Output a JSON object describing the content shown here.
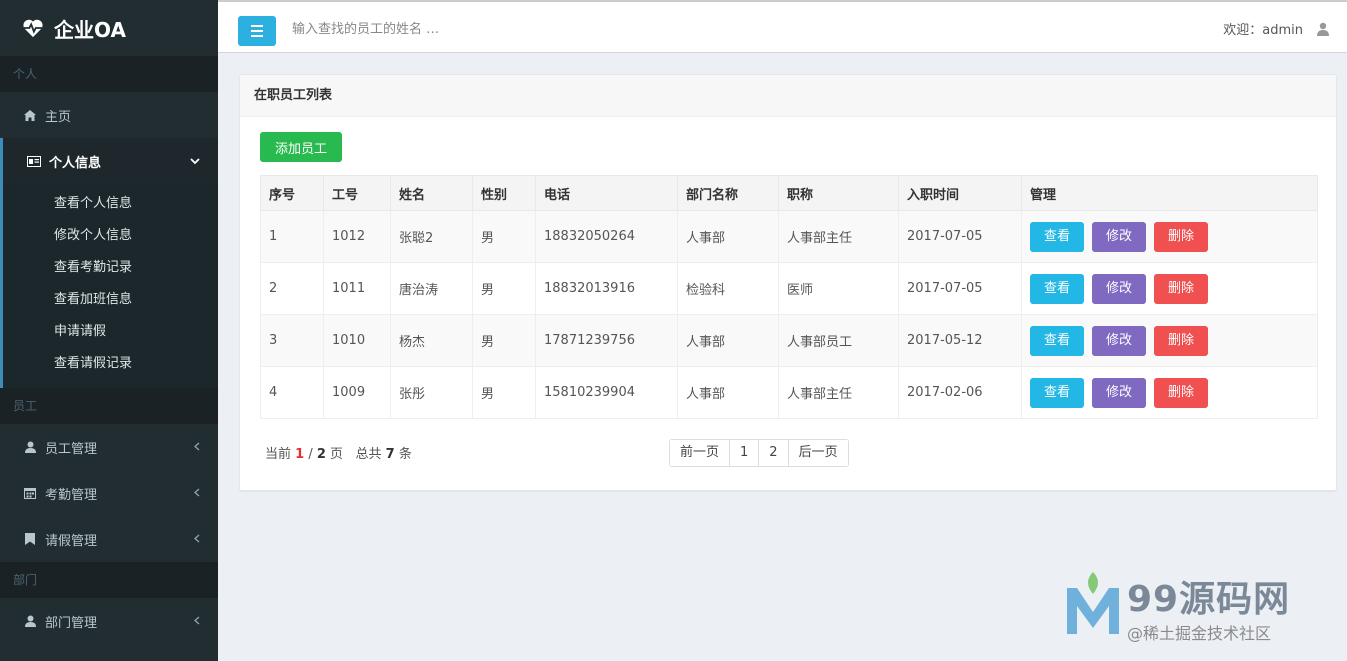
{
  "app": {
    "title": "企业OA"
  },
  "sidebar": {
    "sections": {
      "personal": "个人",
      "staff": "员工",
      "dept": "部门"
    },
    "home_label": "主页",
    "personal_info": {
      "label": "个人信息",
      "items": [
        "查看个人信息",
        "修改个人信息",
        "查看考勤记录",
        "查看加班信息",
        "申请请假",
        "查看请假记录"
      ]
    },
    "staff_mgmt": "员工管理",
    "attendance_mgmt": "考勤管理",
    "leave_mgmt": "请假管理",
    "dept_mgmt": "部门管理"
  },
  "header": {
    "search_placeholder": "输入查找的员工的姓名 …",
    "welcome": "欢迎：admin"
  },
  "main": {
    "box_title": "在职员工列表",
    "add_button": "添加员工",
    "table": {
      "columns": [
        "序号",
        "工号",
        "姓名",
        "性别",
        "电话",
        "部门名称",
        "职称",
        "入职时间",
        "管理"
      ],
      "rows": [
        [
          "1",
          "1012",
          "张聪2",
          "男",
          "18832050264",
          "人事部",
          "人事部主任",
          "2017-07-05"
        ],
        [
          "2",
          "1011",
          "唐治涛",
          "男",
          "18832013916",
          "检验科",
          "医师",
          "2017-07-05"
        ],
        [
          "3",
          "1010",
          "杨杰",
          "男",
          "17871239756",
          "人事部",
          "人事部员工",
          "2017-05-12"
        ],
        [
          "4",
          "1009",
          "张彤",
          "男",
          "15810239904",
          "人事部",
          "人事部主任",
          "2017-02-06"
        ]
      ],
      "actions": {
        "view": "查看",
        "edit": "修改",
        "delete": "删除"
      }
    },
    "pager": {
      "prefix": "当前",
      "current": "1",
      "sep": " / ",
      "total_pages": "2",
      "page_word": "页",
      "total_prefix": "总共",
      "total_count": "7",
      "total_suffix": "条"
    },
    "pagination": [
      "前一页",
      "1",
      "2",
      "后一页"
    ]
  },
  "watermark": {
    "title": "99源码网",
    "sub": "@稀土掘金技术社区"
  },
  "colors": {
    "sidebar_bg": "#222d32",
    "accent_blue": "#2cb0e0",
    "add_green": "#28b94f",
    "view_btn": "#23b7e5",
    "edit_btn": "#7f69c1",
    "delete_btn": "#f05050"
  }
}
